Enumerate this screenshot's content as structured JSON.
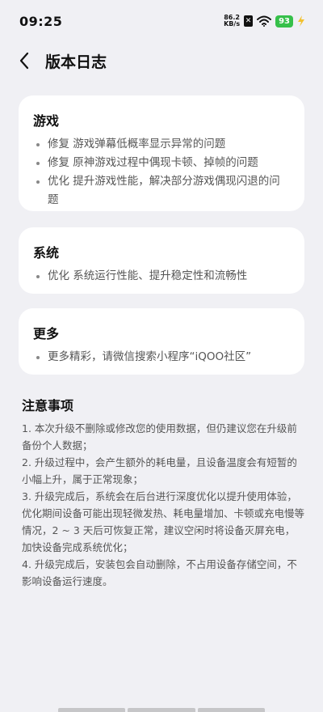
{
  "status_bar": {
    "time": "09:25",
    "net_speed_value": "86.2",
    "net_speed_unit": "KB/s",
    "battery": "93",
    "icons": [
      "sim-icon",
      "wifi-icon",
      "battery-icon",
      "charging-icon"
    ]
  },
  "header": {
    "back_icon": "chevron-left-icon",
    "title": "版本日志"
  },
  "sections": [
    {
      "title": "游戏",
      "items": [
        "修复 游戏弹幕低概率显示异常的问题",
        "修复 原神游戏过程中偶现卡顿、掉帧的问题",
        "优化 提升游戏性能，解决部分游戏偶现闪退的问题"
      ]
    },
    {
      "title": "系统",
      "items": [
        "优化 系统运行性能、提升稳定性和流畅性"
      ]
    },
    {
      "title": "更多",
      "items": [
        "更多精彩，请微信搜索小程序“iQOO社区”"
      ]
    }
  ],
  "notes": {
    "title": "注意事项",
    "items": [
      "1. 本次升级不删除或修改您的使用数据，但仍建议您在升级前备份个人数据；",
      "2. 升级过程中，会产生额外的耗电量，且设备温度会有短暂的小幅上升，属于正常现象；",
      "3. 升级完成后，系统会在后台进行深度优化以提升使用体验，优化期间设备可能出现轻微发热、耗电量增加、卡顿或充电慢等情况，2 ~ 3 天后可恢复正常，建议空闲时将设备灭屏充电，加快设备完成系统优化；",
      "4. 升级完成后，安装包会自动删除，不占用设备存储空间，不影响设备运行速度。"
    ]
  },
  "colors": {
    "background": "#f0f0f4",
    "card": "#ffffff",
    "battery_green": "#36c04a",
    "charge_yellow": "#f2c12e"
  }
}
